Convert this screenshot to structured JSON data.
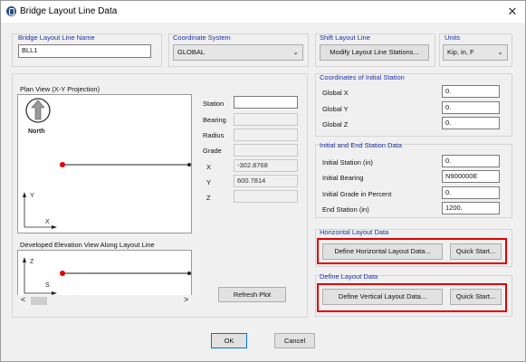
{
  "window": {
    "title": "Bridge Layout Line Data",
    "close_glyph": "✕"
  },
  "name_group": {
    "label": "Bridge Layout Line Name",
    "value": "BLL1"
  },
  "coord_group": {
    "label": "Coordinate System",
    "value": "GLOBAL"
  },
  "shift_group": {
    "label": "Shift Layout Line",
    "button": "Modify Layout Line Stations..."
  },
  "units_group": {
    "label": "Units",
    "value": "Kip, in, F"
  },
  "plan_view": {
    "label": "Plan View (X-Y Projection)",
    "north": "North",
    "axis_y": "Y",
    "axis_x": "X"
  },
  "station_fields": {
    "station": {
      "label": "Station",
      "value": ""
    },
    "bearing": {
      "label": "Bearing",
      "value": ""
    },
    "radius": {
      "label": "Radius",
      "value": ""
    },
    "grade": {
      "label": "Grade",
      "value": ""
    },
    "x": {
      "label": "X",
      "value": "-302.8768"
    },
    "y": {
      "label": "Y",
      "value": "600.7814"
    },
    "z": {
      "label": "Z",
      "value": ""
    }
  },
  "elevation_view": {
    "label": "Developed Elevation View Along Layout Line",
    "axis_z": "Z",
    "axis_s": "S"
  },
  "scroll": {
    "left": "<",
    "right": ">"
  },
  "refresh_button": "Refresh Plot",
  "initial_coords": {
    "label": "Coordinates of Initial Station",
    "x_label": "Global  X",
    "x_value": "0.",
    "y_label": "Global  Y",
    "y_value": "0.",
    "z_label": "Global  Z",
    "z_value": "0."
  },
  "station_data": {
    "label": "Initial and End Station Data",
    "initial_station_label": "Initial Station  (in)",
    "initial_station_value": "0.",
    "initial_bearing_label": "Initial Bearing",
    "initial_bearing_value": "N900000E",
    "initial_grade_label": "Initial Grade in Percent",
    "initial_grade_value": "0.",
    "end_station_label": "End Station  (in)",
    "end_station_value": "1200."
  },
  "horizontal": {
    "label": "Horizontal Layout Data",
    "define_button": "Define Horizontal Layout Data...",
    "quick_start": "Quick Start..."
  },
  "vertical": {
    "label": "Define Layout Data",
    "define_button": "Define Vertical Layout Data...",
    "quick_start": "Quick Start..."
  },
  "footer": {
    "ok": "OK",
    "cancel": "Cancel"
  },
  "colors": {
    "group_label": "#1c2fa6",
    "highlight": "#e00000",
    "point": "#e00000"
  }
}
